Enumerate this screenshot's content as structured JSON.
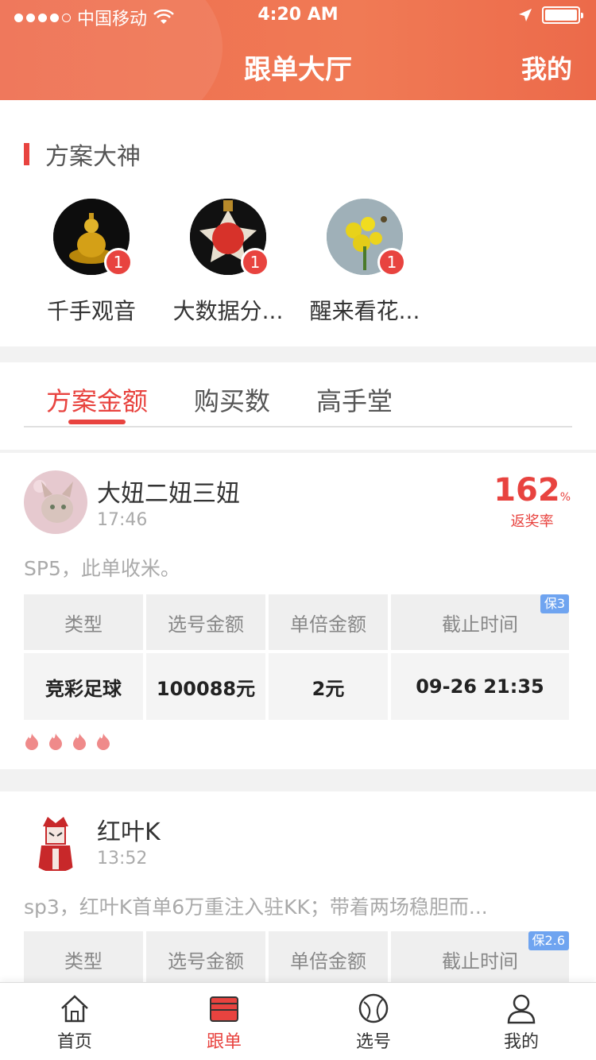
{
  "status_bar": {
    "carrier": "中国移动",
    "time": "4:20 AM"
  },
  "nav": {
    "title": "跟单大厅",
    "right": "我的"
  },
  "masters": {
    "title": "方案大神",
    "items": [
      {
        "name": "千手观音",
        "badge": "1"
      },
      {
        "name": "大数据分...",
        "badge": "1"
      },
      {
        "name": "醒来看花...",
        "badge": "1"
      }
    ]
  },
  "tabs": {
    "items": [
      "方案金额",
      "购买数",
      "高手堂"
    ],
    "active": 0
  },
  "cards": [
    {
      "name": "大妞二妞三妞",
      "time": "17:46",
      "rate": "162",
      "rate_unit": "%",
      "rate_label": "返奖率",
      "desc": "SP5，此单收米。",
      "badge": "保3",
      "headers": [
        "类型",
        "选号金额",
        "单倍金额",
        "截止时间"
      ],
      "values": [
        "竞彩足球",
        "100088元",
        "2元",
        "09-26 21:35"
      ],
      "flames": 4
    },
    {
      "name": "红叶K",
      "time": "13:52",
      "desc": "sp3，红叶K首单6万重注入驻KK；带着两场稳胆而...",
      "badge": "保2.6",
      "headers": [
        "类型",
        "选号金额",
        "单倍金额",
        "截止时间"
      ]
    }
  ],
  "tabbar": {
    "items": [
      "首页",
      "跟单",
      "选号",
      "我的"
    ],
    "active": 1
  },
  "colors": {
    "accent": "#e8433f",
    "header": "#ee6d4f",
    "badge_blue": "#6fa4f0"
  }
}
